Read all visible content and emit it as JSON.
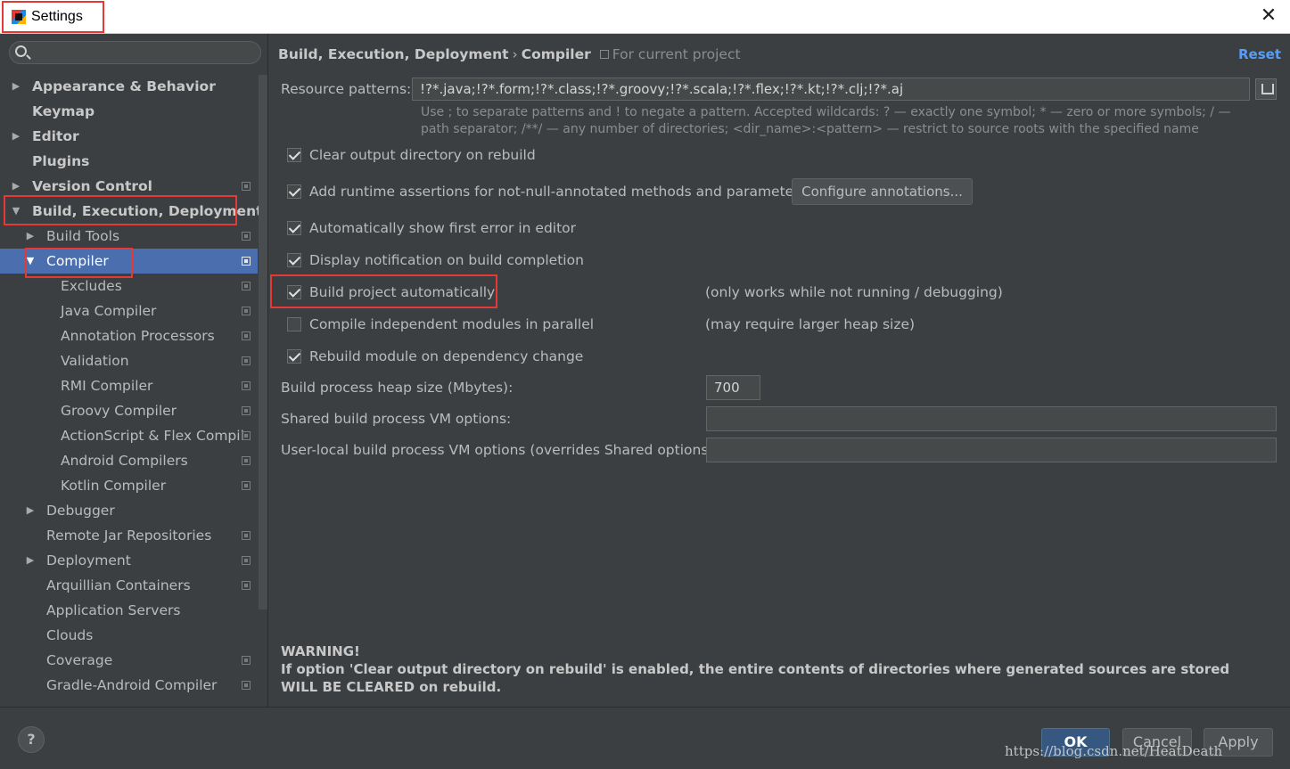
{
  "window": {
    "title": "Settings",
    "close_glyph": "✕"
  },
  "search": {
    "placeholder": ""
  },
  "tree": [
    {
      "label": "Appearance & Behavior",
      "arrow": "▶",
      "bold": true,
      "level": 0,
      "proj": false
    },
    {
      "label": "Keymap",
      "arrow": "",
      "bold": true,
      "level": 0,
      "proj": false
    },
    {
      "label": "Editor",
      "arrow": "▶",
      "bold": true,
      "level": 0,
      "proj": false
    },
    {
      "label": "Plugins",
      "arrow": "",
      "bold": true,
      "level": 0,
      "proj": false
    },
    {
      "label": "Version Control",
      "arrow": "▶",
      "bold": true,
      "level": 0,
      "proj": true
    },
    {
      "label": "Build, Execution, Deployment",
      "arrow": "▼",
      "bold": true,
      "level": 0,
      "proj": false
    },
    {
      "label": "Build Tools",
      "arrow": "▶",
      "bold": false,
      "level": 1,
      "proj": true
    },
    {
      "label": "Compiler",
      "arrow": "▼",
      "bold": false,
      "level": 1,
      "proj": true,
      "selected": true
    },
    {
      "label": "Excludes",
      "arrow": "",
      "bold": false,
      "level": 2,
      "proj": true
    },
    {
      "label": "Java Compiler",
      "arrow": "",
      "bold": false,
      "level": 2,
      "proj": true
    },
    {
      "label": "Annotation Processors",
      "arrow": "",
      "bold": false,
      "level": 2,
      "proj": true
    },
    {
      "label": "Validation",
      "arrow": "",
      "bold": false,
      "level": 2,
      "proj": true
    },
    {
      "label": "RMI Compiler",
      "arrow": "",
      "bold": false,
      "level": 2,
      "proj": true
    },
    {
      "label": "Groovy Compiler",
      "arrow": "",
      "bold": false,
      "level": 2,
      "proj": true
    },
    {
      "label": "ActionScript & Flex Compil",
      "arrow": "",
      "bold": false,
      "level": 2,
      "proj": true
    },
    {
      "label": "Android Compilers",
      "arrow": "",
      "bold": false,
      "level": 2,
      "proj": true
    },
    {
      "label": "Kotlin Compiler",
      "arrow": "",
      "bold": false,
      "level": 2,
      "proj": true
    },
    {
      "label": "Debugger",
      "arrow": "▶",
      "bold": false,
      "level": 1,
      "proj": false
    },
    {
      "label": "Remote Jar Repositories",
      "arrow": "",
      "bold": false,
      "level": 1,
      "proj": true
    },
    {
      "label": "Deployment",
      "arrow": "▶",
      "bold": false,
      "level": 1,
      "proj": true
    },
    {
      "label": "Arquillian Containers",
      "arrow": "",
      "bold": false,
      "level": 1,
      "proj": true
    },
    {
      "label": "Application Servers",
      "arrow": "",
      "bold": false,
      "level": 1,
      "proj": false
    },
    {
      "label": "Clouds",
      "arrow": "",
      "bold": false,
      "level": 1,
      "proj": false
    },
    {
      "label": "Coverage",
      "arrow": "",
      "bold": false,
      "level": 1,
      "proj": true
    },
    {
      "label": "Gradle-Android Compiler",
      "arrow": "",
      "bold": false,
      "level": 1,
      "proj": true
    }
  ],
  "breadcrumb": {
    "section": "Build, Execution, Deployment",
    "sep": "›",
    "page": "Compiler",
    "scope": "For current project"
  },
  "reset_label": "Reset",
  "resource": {
    "label": "Resource patterns:",
    "value": "!?*.java;!?*.form;!?*.class;!?*.groovy;!?*.scala;!?*.flex;!?*.kt;!?*.clj;!?*.aj",
    "hint": "Use ; to separate patterns and ! to negate a pattern. Accepted wildcards: ? — exactly one symbol; * — zero or more symbols; / — path separator; /**/ — any number of directories; <dir_name>:<pattern> — restrict to source roots with the specified name"
  },
  "options": [
    {
      "label": "Clear output directory on rebuild",
      "checked": true,
      "note": ""
    },
    {
      "label": "Add runtime assertions for not-null-annotated methods and parameters",
      "checked": true,
      "note": ""
    },
    {
      "label": "Automatically show first error in editor",
      "checked": true,
      "note": ""
    },
    {
      "label": "Display notification on build completion",
      "checked": true,
      "note": ""
    },
    {
      "label": "Build project automatically",
      "checked": true,
      "note": "(only works while not running / debugging)"
    },
    {
      "label": "Compile independent modules in parallel",
      "checked": false,
      "note": "(may require larger heap size)"
    },
    {
      "label": "Rebuild module on dependency change",
      "checked": true,
      "note": ""
    }
  ],
  "configure_button": "Configure annotations...",
  "heap": {
    "label": "Build process heap size (Mbytes):",
    "value": "700"
  },
  "shared_vm": {
    "label": "Shared build process VM options:",
    "value": ""
  },
  "user_vm": {
    "label": "User-local build process VM options (overrides Shared options):",
    "value": ""
  },
  "warning": {
    "title": "WARNING!",
    "text": "If option 'Clear output directory on rebuild' is enabled, the entire contents of directories where generated sources are stored WILL BE CLEARED on rebuild."
  },
  "footer": {
    "help": "?",
    "ok": "OK",
    "cancel": "Cancel",
    "apply": "Apply",
    "watermark": "https://blog.csdn.net/HeatDeath"
  },
  "colors": {
    "selection": "#4b6eaf",
    "highlight_box": "#e53935",
    "link": "#589df6",
    "background": "#3c3f41"
  }
}
